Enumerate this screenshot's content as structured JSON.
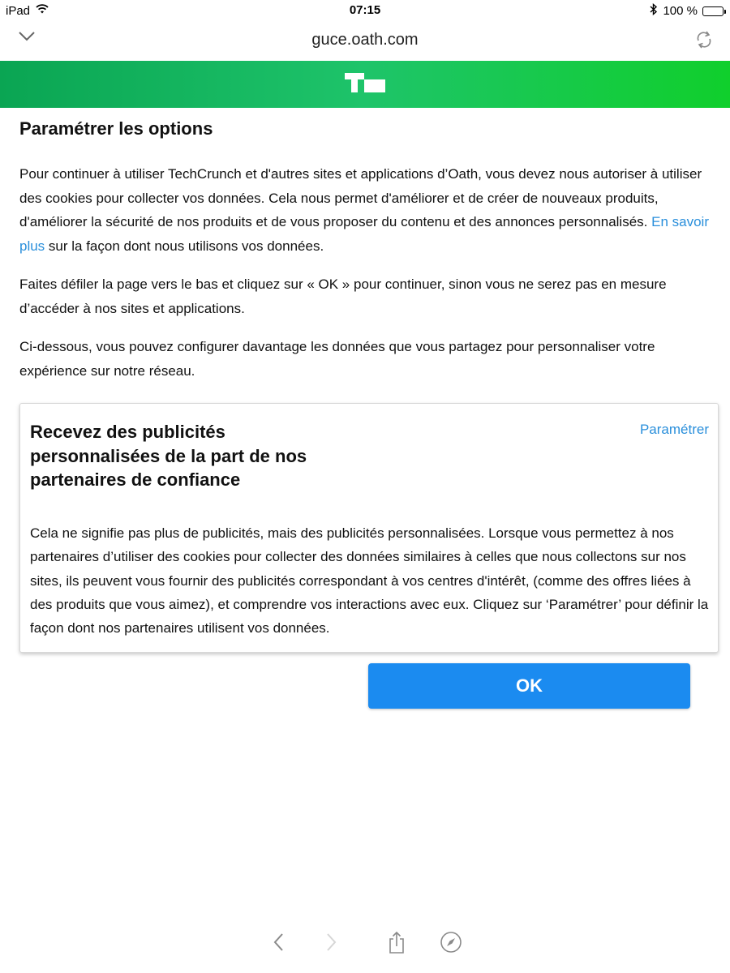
{
  "status_bar": {
    "device": "iPad",
    "time": "07:15",
    "battery_percent": "100 %"
  },
  "browser": {
    "url": "guce.oath.com"
  },
  "banner": {
    "logo": "TC",
    "color_start": "#0aa553",
    "color_end": "#10cf2c"
  },
  "page": {
    "title": "Paramétrer les options",
    "intro_before_link": "Pour continuer à utiliser TechCrunch et d'autres sites et applications d’Oath, vous devez nous autoriser à utiliser des cookies pour collecter vos données. Cela nous permet d'améliorer et de créer de nouveaux produits, d'améliorer la sécurité de nos produits et de vous proposer du contenu et des annonces personnalisés. ",
    "intro_link": "En savoir plus",
    "intro_after_link": " sur la façon dont nous utilisons vos données.",
    "scroll_instruction": "Faites défiler la page vers le bas et cliquez sur « OK » pour continuer, sinon vous ne serez pas en mesure d’accéder à nos sites et applications.",
    "configure_intro": "Ci-dessous, vous pouvez configurer davantage les données que vous partagez pour personnaliser votre expérience sur notre réseau."
  },
  "card": {
    "title": "Recevez des publicités personnalisées de la part de nos partenaires de confiance",
    "configure_label": "Paramétrer",
    "body": "Cela ne signifie pas plus de publicités, mais des publicités personnalisées. Lorsque vous permettez à nos partenaires d’utiliser des cookies pour collecter des données similaires à celles que nous collectons sur nos sites, ils peuvent vous fournir des publicités correspondant à vos centres d'intérêt, (comme des offres liées à des produits que vous aimez), et comprendre vos interactions avec eux. Cliquez sur ‘Paramétrer’ pour définir la façon dont nos partenaires utilisent vos données."
  },
  "ok_button": {
    "label": "OK",
    "color": "#1b8bf0"
  },
  "toolbar": {
    "icons": [
      "back-icon",
      "forward-icon",
      "share-icon",
      "compass-icon"
    ]
  },
  "colors": {
    "link": "#2a8fdb"
  }
}
